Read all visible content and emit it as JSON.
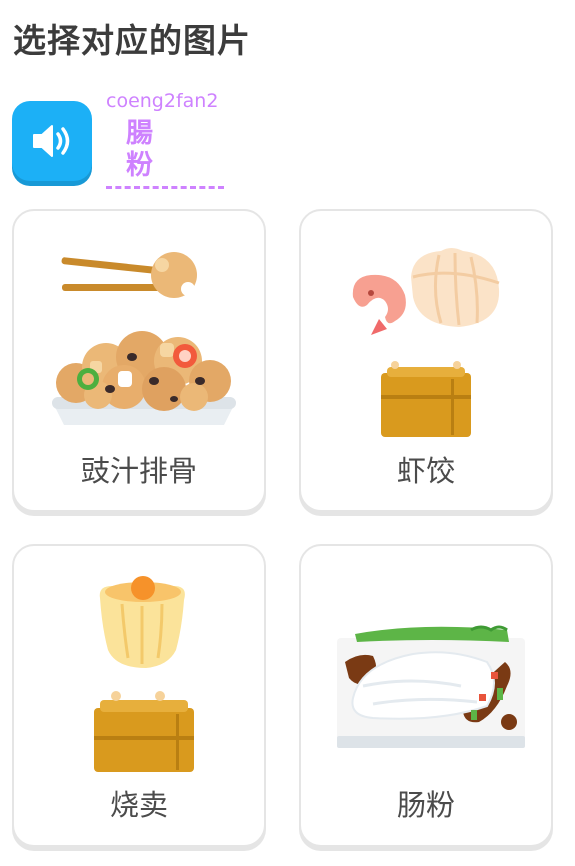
{
  "header": {
    "title": "选择对应的图片"
  },
  "prompt": {
    "audio_icon": "speaker-icon",
    "romanization": "coeng2fan2",
    "word": "腸 粉"
  },
  "choices": [
    {
      "label": "豉汁排骨",
      "image": "black-bean-spare-ribs-image"
    },
    {
      "label": "虾饺",
      "image": "shrimp-dumpling-image"
    },
    {
      "label": "烧卖",
      "image": "siu-mai-image"
    },
    {
      "label": "肠粉",
      "image": "rice-noodle-roll-image"
    }
  ],
  "colors": {
    "audio_button": "#1cb0f6",
    "prompt_text": "#ce82ff",
    "card_border": "#e5e5e5"
  }
}
